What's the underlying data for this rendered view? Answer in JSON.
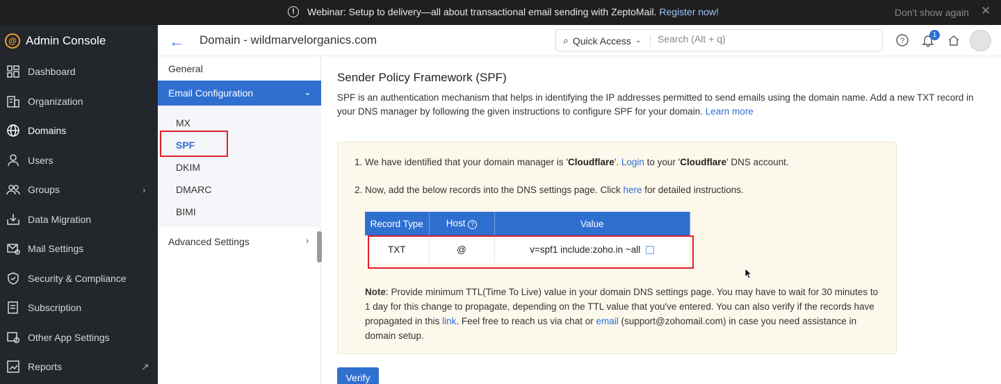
{
  "banner": {
    "message": "Webinar: Setup to delivery—all about transactional email sending with ZeptoMail.",
    "register_link": "Register now!",
    "dont_show": "Don't show again",
    "close": "✕"
  },
  "sidebar": {
    "brand": "Admin Console",
    "items": [
      {
        "label": "Dashboard",
        "icon": "dashboard-icon"
      },
      {
        "label": "Organization",
        "icon": "organization-icon"
      },
      {
        "label": "Domains",
        "icon": "globe-icon",
        "active": true
      },
      {
        "label": "Users",
        "icon": "user-icon"
      },
      {
        "label": "Groups",
        "icon": "groups-icon"
      },
      {
        "label": "Data Migration",
        "icon": "migration-icon"
      },
      {
        "label": "Mail Settings",
        "icon": "mail-settings-icon"
      },
      {
        "label": "Security & Compliance",
        "icon": "shield-icon"
      },
      {
        "label": "Subscription",
        "icon": "subscription-icon"
      },
      {
        "label": "Other App Settings",
        "icon": "app-settings-icon"
      },
      {
        "label": "Reports",
        "icon": "reports-icon"
      }
    ]
  },
  "header": {
    "title": "Domain - wildmarvelorganics.com",
    "quick_access": "Quick Access",
    "search_placeholder": "Search (Alt + q)",
    "notification_count": "1"
  },
  "subnav": {
    "general": "General",
    "email_config": "Email Configuration",
    "children": [
      "MX",
      "SPF",
      "DKIM",
      "DMARC",
      "BIMI"
    ],
    "active_child": "SPF",
    "advanced": "Advanced Settings"
  },
  "main": {
    "title": "Sender Policy Framework (SPF)",
    "desc": "SPF is an authentication mechanism that helps in identifying the IP addresses permitted to send emails using the domain name. Add a new TXT record in your DNS manager by following the given instructions to configure SPF for your domain.",
    "learn_more": "Learn more",
    "step1_pre": "1. We have identified that your domain manager is '",
    "step1_mgr": "Cloudflare",
    "step1_mid": "'. ",
    "step1_login": "Login",
    "step1_mid2": " to your '",
    "step1_mgr2": "Cloudflare",
    "step1_post": "' DNS account.",
    "step2_pre": "2. Now, add the below records into the DNS settings page. Click ",
    "step2_here": "here",
    "step2_post": " for detailed instructions.",
    "table": {
      "headers": [
        "Record Type",
        "Host",
        "Value"
      ],
      "row": [
        "TXT",
        "@",
        "v=spf1 include:zoho.in ~all"
      ]
    },
    "note_label": "Note",
    "note_1": ": Provide minimum TTL(Time To Live) value in your domain DNS settings page. You may have to wait for 30 minutes to 1 day for this change to propagate, depending on the TTL value that you've entered. You can also verify if the records have propagated in this ",
    "note_link": "link",
    "note_2": ". Feel free to reach us via chat or ",
    "note_email": "email",
    "note_3": " (support@zohomail.com) in case you need assistance in domain setup.",
    "verify": "Verify"
  },
  "colors": {
    "accent": "#2f6fd0",
    "sidebar_bg": "#23262b",
    "highlight_red": "#e21c2a",
    "box_bg": "#fdf8ec"
  }
}
